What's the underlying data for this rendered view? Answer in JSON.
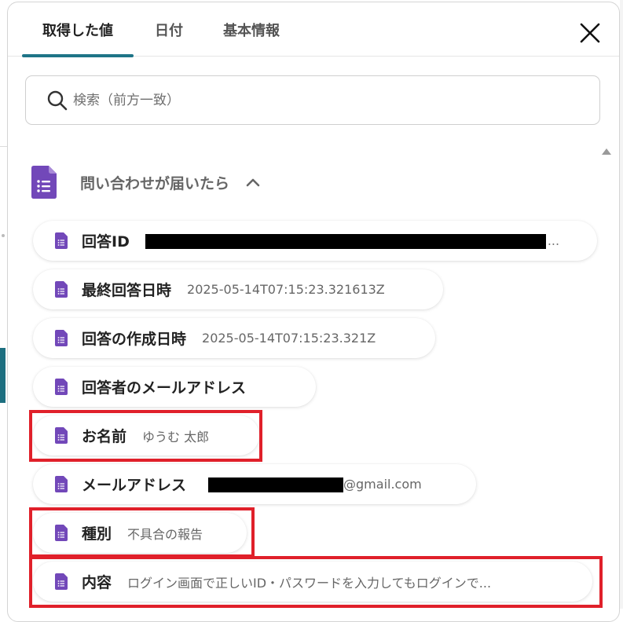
{
  "tabs": [
    {
      "label": "取得した値",
      "active": true
    },
    {
      "label": "日付",
      "active": false
    },
    {
      "label": "基本情報",
      "active": false
    }
  ],
  "search": {
    "placeholder": "検索（前方一致）",
    "value": ""
  },
  "section": {
    "title": "問い合わせが届いたら",
    "icon": "google-forms-icon",
    "expanded": true
  },
  "fields": [
    {
      "label": "回答ID",
      "value": "",
      "redacted": true,
      "suffix": "..."
    },
    {
      "label": "最終回答日時",
      "value": "2025-05-14T07:15:23.321613Z"
    },
    {
      "label": "回答の作成日時",
      "value": "2025-05-14T07:15:23.321Z"
    },
    {
      "label": "回答者のメールアドレス",
      "value": ""
    },
    {
      "label": "お名前",
      "value": "ゆうむ 太郎",
      "highlighted": true
    },
    {
      "label": "メールアドレス",
      "value": "@gmail.com",
      "redacted_prefix": true
    },
    {
      "label": "種別",
      "value": "不具合の報告",
      "highlighted": true
    },
    {
      "label": "内容",
      "value": "ログイン画面で正しいID・パスワードを入力してもログインで...",
      "highlighted": true
    }
  ],
  "colors": {
    "accent": "#1e7487",
    "forms_purple": "#7248b9",
    "highlight_red": "#e0202a"
  }
}
